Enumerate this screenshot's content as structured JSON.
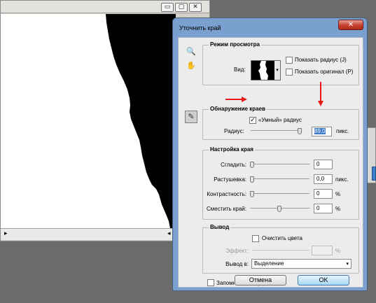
{
  "dialog": {
    "title": "Уточнить край",
    "close_glyph": "✕"
  },
  "doc_window": {
    "min_glyph": "▭",
    "max_glyph": "▢",
    "close_glyph": "✕",
    "scroll_left_glyph": "▸",
    "scroll_right_glyph": "◂"
  },
  "tools": {
    "zoom_glyph": "🔍",
    "hand_glyph": "✋",
    "brush_glyph": "✎"
  },
  "view_mode": {
    "title": "Режим просмотра",
    "view_label": "Вид:",
    "dropdown_glyph": "▾",
    "show_radius_label": "Показать радиус (J)",
    "show_original_label": "Показать оригинал (P)"
  },
  "edge_detection": {
    "title": "Обнаружение краев",
    "smart_radius_label": "«Умный» радиус",
    "smart_radius_checked": true,
    "check_glyph": "✓",
    "radius_label": "Радиус:",
    "radius_value": "89,0",
    "radius_unit": "пикс."
  },
  "adjust_edge": {
    "title": "Настройка края",
    "smooth_label": "Сгладить:",
    "smooth_value": "0",
    "feather_label": "Растушевка:",
    "feather_value": "0,0",
    "feather_unit": "пикс.",
    "contrast_label": "Контрастность:",
    "contrast_value": "0",
    "contrast_unit": "%",
    "shift_label": "Сместить край:",
    "shift_value": "0",
    "shift_unit": "%"
  },
  "output": {
    "title": "Вывод",
    "decontaminate_label": "Очистить цвета",
    "amount_label": "Эффект:",
    "amount_unit": "%",
    "output_to_label": "Вывод в:",
    "output_to_value": "Выделение",
    "caret_glyph": "▾"
  },
  "remember_label": "Запомнить настройки",
  "buttons": {
    "cancel": "Отмена",
    "ok": "OK"
  },
  "colors": {
    "annotation_arrow": "#e31b1b",
    "dialog_frame": "#7aa0cf",
    "selection": "#3a77c9"
  }
}
